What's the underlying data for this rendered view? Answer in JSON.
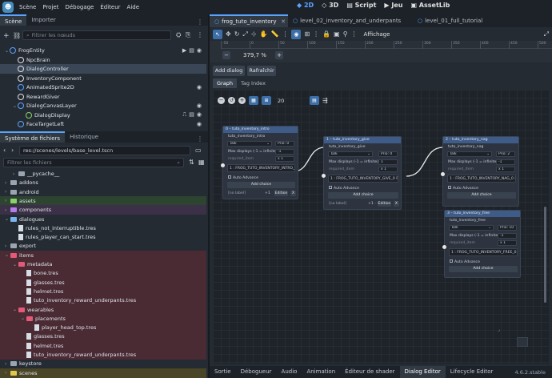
{
  "menubar": {
    "items": [
      "Scène",
      "Projet",
      "Débogage",
      "Éditeur",
      "Aide"
    ],
    "workspaces": [
      {
        "label": "2D",
        "active": true
      },
      {
        "label": "3D",
        "active": false
      },
      {
        "label": "Script",
        "active": false
      },
      {
        "label": "Jeu",
        "active": false
      },
      {
        "label": "AssetLib",
        "active": false
      }
    ]
  },
  "scene_dock": {
    "tabs": [
      "Scène",
      "Importer"
    ],
    "filter_placeholder": "Filtrer les nœuds",
    "nodes": [
      {
        "label": "FrogEntity",
        "indent": 0,
        "color": "#5aa4ff",
        "selected": false,
        "icons": [
          "film-icon",
          "script-icon",
          "eye-icon"
        ]
      },
      {
        "label": "NpcBrain",
        "indent": 1,
        "color": "#e0e0e0",
        "selected": false,
        "icons": []
      },
      {
        "label": "DialogController",
        "indent": 1,
        "color": "#e0e0e0",
        "selected": true,
        "icons": []
      },
      {
        "label": "InventoryComponent",
        "indent": 1,
        "color": "#e0e0e0",
        "selected": false,
        "icons": []
      },
      {
        "label": "AnimatedSprite2D",
        "indent": 1,
        "color": "#5aa4ff",
        "selected": false,
        "icons": [
          "eye-icon"
        ]
      },
      {
        "label": "RewardGiver",
        "indent": 1,
        "color": "#e0e0e0",
        "selected": false,
        "icons": []
      },
      {
        "label": "DialogCanvasLayer",
        "indent": 1,
        "color": "#5aa4ff",
        "selected": false,
        "icons": [
          "eye-icon"
        ]
      },
      {
        "label": "DialogDisplay",
        "indent": 2,
        "color": "#8ad16b",
        "selected": false,
        "icons": [
          "signal-icon",
          "script-icon",
          "eye-icon"
        ]
      },
      {
        "label": "FaceTargetLeft",
        "indent": 1,
        "color": "#5aa4ff",
        "selected": false,
        "icons": [
          "eye-icon"
        ]
      }
    ]
  },
  "fs_dock": {
    "tabs": [
      "Système de fichiers",
      "Historique"
    ],
    "path": "res://scenes/levels/base_level.tscn",
    "filter_placeholder": "Filtrer les fichiers",
    "items": [
      {
        "label": "__pycache__",
        "indent": 1,
        "type": "folder",
        "fold": "#9aa5b1",
        "hl": ""
      },
      {
        "label": "addons",
        "indent": 0,
        "type": "folder",
        "fold": "#9aa5b1",
        "hl": ""
      },
      {
        "label": "android",
        "indent": 0,
        "type": "folder",
        "fold": "#9aa5b1",
        "hl": ""
      },
      {
        "label": "assets",
        "indent": 0,
        "type": "folder",
        "fold": "#8bd16b",
        "hl": "green"
      },
      {
        "label": "components",
        "indent": 0,
        "type": "folder",
        "fold": "#b37ee8",
        "hl": "purple"
      },
      {
        "label": "dialogues",
        "indent": 0,
        "type": "folder",
        "fold": "#7ab4f0",
        "hl": ""
      },
      {
        "label": "rules_not_interruptible.tres",
        "indent": 1,
        "type": "file",
        "fold": "",
        "hl": ""
      },
      {
        "label": "rules_player_can_start.tres",
        "indent": 1,
        "type": "file",
        "fold": "",
        "hl": ""
      },
      {
        "label": "export",
        "indent": 0,
        "type": "folder",
        "fold": "#9aa5b1",
        "hl": ""
      },
      {
        "label": "items",
        "indent": 0,
        "type": "folder",
        "fold": "#e3597a",
        "hl": "red"
      },
      {
        "label": "metadata",
        "indent": 1,
        "type": "folder",
        "fold": "#e3597a",
        "hl": "red"
      },
      {
        "label": "bone.tres",
        "indent": 2,
        "type": "file",
        "fold": "",
        "hl": "red"
      },
      {
        "label": "glasses.tres",
        "indent": 2,
        "type": "file",
        "fold": "",
        "hl": "red"
      },
      {
        "label": "helmet.tres",
        "indent": 2,
        "type": "file",
        "fold": "",
        "hl": "red"
      },
      {
        "label": "tuto_inventory_reward_underpants.tres",
        "indent": 2,
        "type": "file",
        "fold": "",
        "hl": "red"
      },
      {
        "label": "wearables",
        "indent": 1,
        "type": "folder",
        "fold": "#e3597a",
        "hl": "red"
      },
      {
        "label": "placements",
        "indent": 2,
        "type": "folder",
        "fold": "#e3597a",
        "hl": "red"
      },
      {
        "label": "player_head_top.tres",
        "indent": 3,
        "type": "file",
        "fold": "",
        "hl": "red"
      },
      {
        "label": "glasses.tres",
        "indent": 2,
        "type": "file",
        "fold": "",
        "hl": "red"
      },
      {
        "label": "helmet.tres",
        "indent": 2,
        "type": "file",
        "fold": "",
        "hl": "red"
      },
      {
        "label": "tuto_inventory_reward_underpants.tres",
        "indent": 2,
        "type": "file",
        "fold": "",
        "hl": "red"
      },
      {
        "label": "keystore",
        "indent": 0,
        "type": "folder",
        "fold": "#9aa5b1",
        "hl": ""
      },
      {
        "label": "scenes",
        "indent": 0,
        "type": "folder",
        "fold": "#e3c74f",
        "hl": "yellow"
      }
    ]
  },
  "editor_tabs": [
    "frog_tuto_inventory",
    "level_02_inventory_and_underpants",
    "level_01_full_tutorial"
  ],
  "toolbar": {
    "affichage": "Affichage"
  },
  "ruler": {
    "labels": [
      "-50",
      "0",
      "50",
      "100",
      "150",
      "200",
      "250",
      "300",
      "350",
      "400",
      "450",
      "500"
    ]
  },
  "zoom": {
    "value": "379,7 %"
  },
  "dialog_panel": {
    "buttons": [
      "Add dialog",
      "Rafraîchir"
    ],
    "tabs": [
      "Graph",
      "Tag Index"
    ],
    "snap_value": "20"
  },
  "graph": {
    "nodes": [
      {
        "title": "0 – tuto_inventory_intro",
        "id_label": "tuto_inventory_intro",
        "dropdown": "Talk",
        "prio": "Prio: 0",
        "max_displays_label": "Max displays (-1 = infinite)",
        "max_displays": "-1",
        "required_label": "required_item",
        "required_count": "x 1",
        "text": "1 : FROG_TUTO_INVENTORY_INTRO_0",
        "auto_advance": "Auto Advance",
        "add_choice": "Add choice",
        "footer_left": "[no label]",
        "footer_num": "+1",
        "footer_btn": "Edition",
        "footer_x": "X"
      },
      {
        "title": "1 – tuto_inventory_give",
        "id_label": "tuto_inventory_give",
        "dropdown": "Talk",
        "prio": "Prio: 0",
        "max_displays_label": "Max displays (-1 = infinite)",
        "max_displays": "1",
        "required_label": "required_item",
        "required_count": "x 1",
        "text": "1 : FROG_TUTO_INVENTORY_GIVE_0 F...",
        "auto_advance": "Auto Advance",
        "add_choice": "Add choice",
        "footer_left": "[no label]",
        "footer_num": "+1 · -1",
        "footer_btn": "Edition",
        "footer_x": "X"
      },
      {
        "title": "2 – tuto_inventory_nag",
        "id_label": "tuto_inventory_nag",
        "dropdown": "Talk",
        "prio": "Prio: 2",
        "max_displays_label": "Max displays (-1 = infinite)",
        "max_displays": "-1",
        "required_label": "required_item",
        "required_count": "x 1",
        "text": "1 : FROG_TUTO_INVENTORY_NAG_0 FR...",
        "auto_advance": "Auto Advance",
        "add_choice": "Add choice"
      },
      {
        "title": "3 – tuto_inventory_free",
        "id_label": "tuto_inventory_free",
        "dropdown": "Talk",
        "prio": "Prio: 10",
        "max_displays_label": "Max displays (-1 = infinite)",
        "max_displays": "-1",
        "required_label": "required_item",
        "required_count": "x 1",
        "text": "1 : FROG_TUTO_INVENTORY_FREE_0 F...",
        "auto_advance": "Auto Advance",
        "add_choice": "Add choice"
      }
    ]
  },
  "bottom_panel": {
    "tabs": [
      "Sortie",
      "Débogueur",
      "Audio",
      "Animation",
      "Éditeur de shader",
      "Dialog Editor",
      "Lifecycle Editor"
    ],
    "active_tab": "Dialog Editor",
    "version": "4.6.2.stable"
  }
}
